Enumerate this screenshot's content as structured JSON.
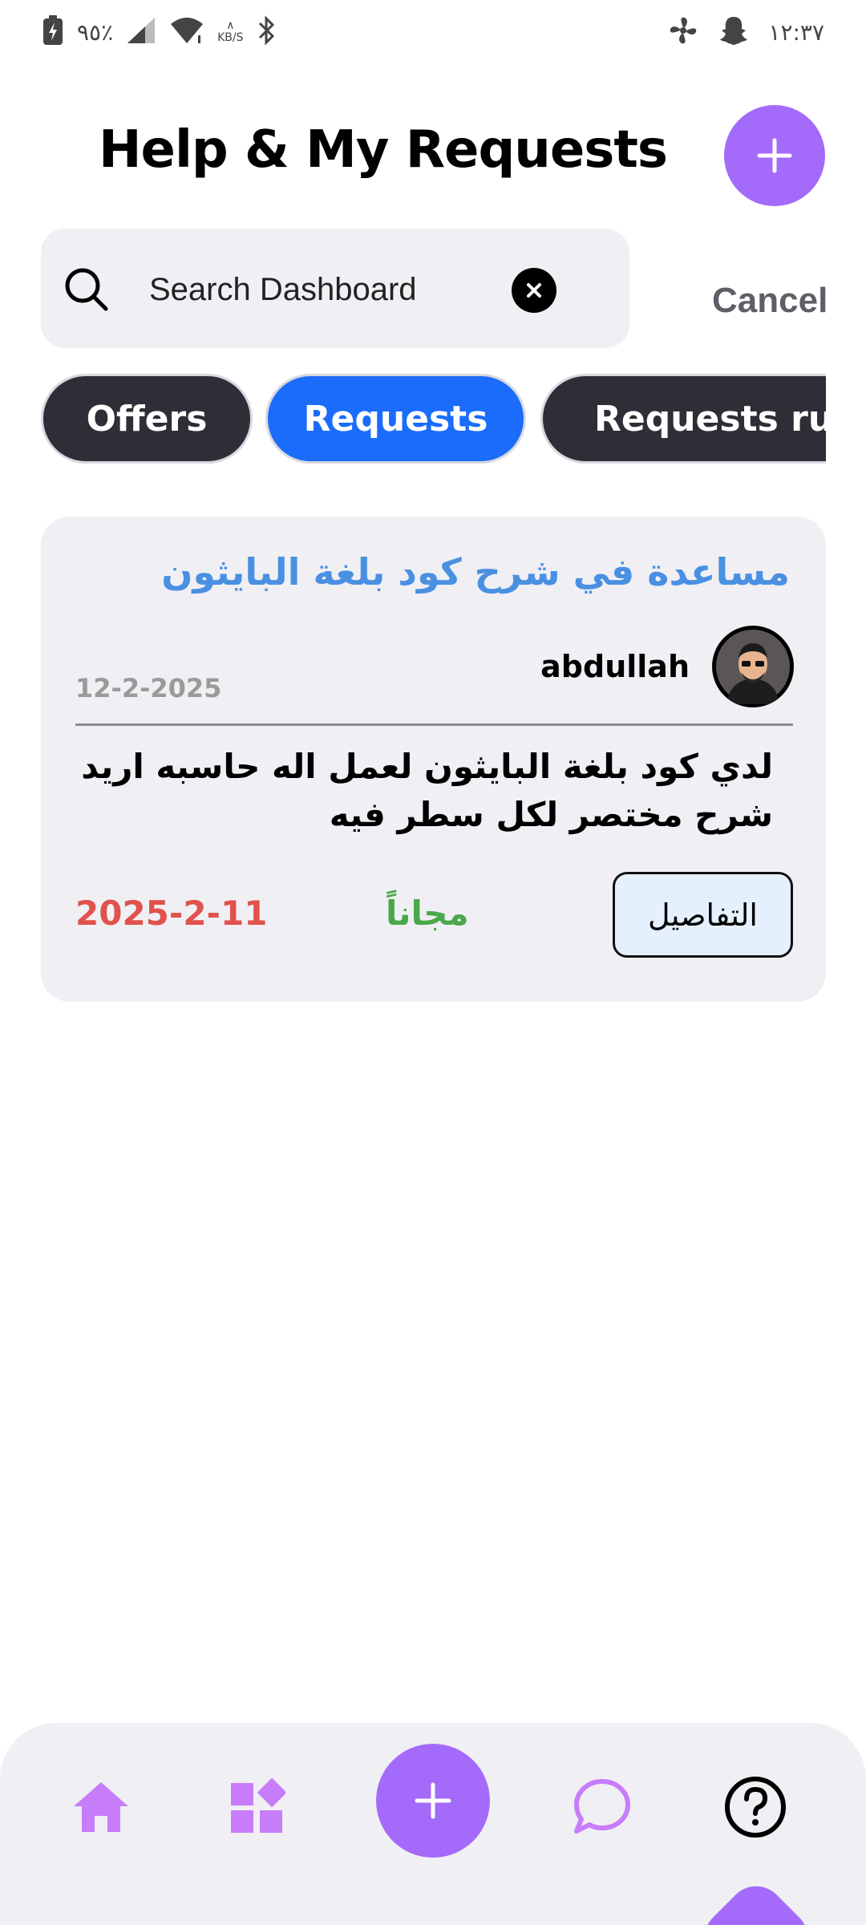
{
  "status_bar": {
    "battery_percent": "٩٥٪",
    "network_speed_top": "∧",
    "network_speed_unit": "KB/S",
    "time": "١٢:٣٧"
  },
  "header": {
    "title": "Help & My Requests"
  },
  "search": {
    "placeholder": "Search Dashboard",
    "cancel_label": "Cancel"
  },
  "tabs": [
    {
      "label": "Offers",
      "active": false
    },
    {
      "label": "Requests",
      "active": true
    },
    {
      "label": "Requests runi",
      "active": false
    }
  ],
  "request_card": {
    "title": "مساعدة في شرح كود بلغة البايثون",
    "username": "abdullah",
    "created_date": "12-2-2025",
    "description": "لدي كود بلغة البايثون لعمل اله حاسبه اريد شرح مختصر لكل سطر فيه",
    "deadline": "2025-2-11",
    "price": "مجاناً",
    "details_label": "التفاصيل"
  },
  "bottom_nav": {
    "items": [
      "home-icon",
      "apps-icon",
      "add-icon",
      "chat-icon",
      "help-icon"
    ]
  },
  "colors": {
    "accent_purple": "#a46bfa",
    "tab_active": "#1b6cfb",
    "tab_inactive": "#2d2e36",
    "title_blue": "#4a90e2",
    "deadline_red": "#e0524b",
    "price_green": "#4aa84a"
  }
}
